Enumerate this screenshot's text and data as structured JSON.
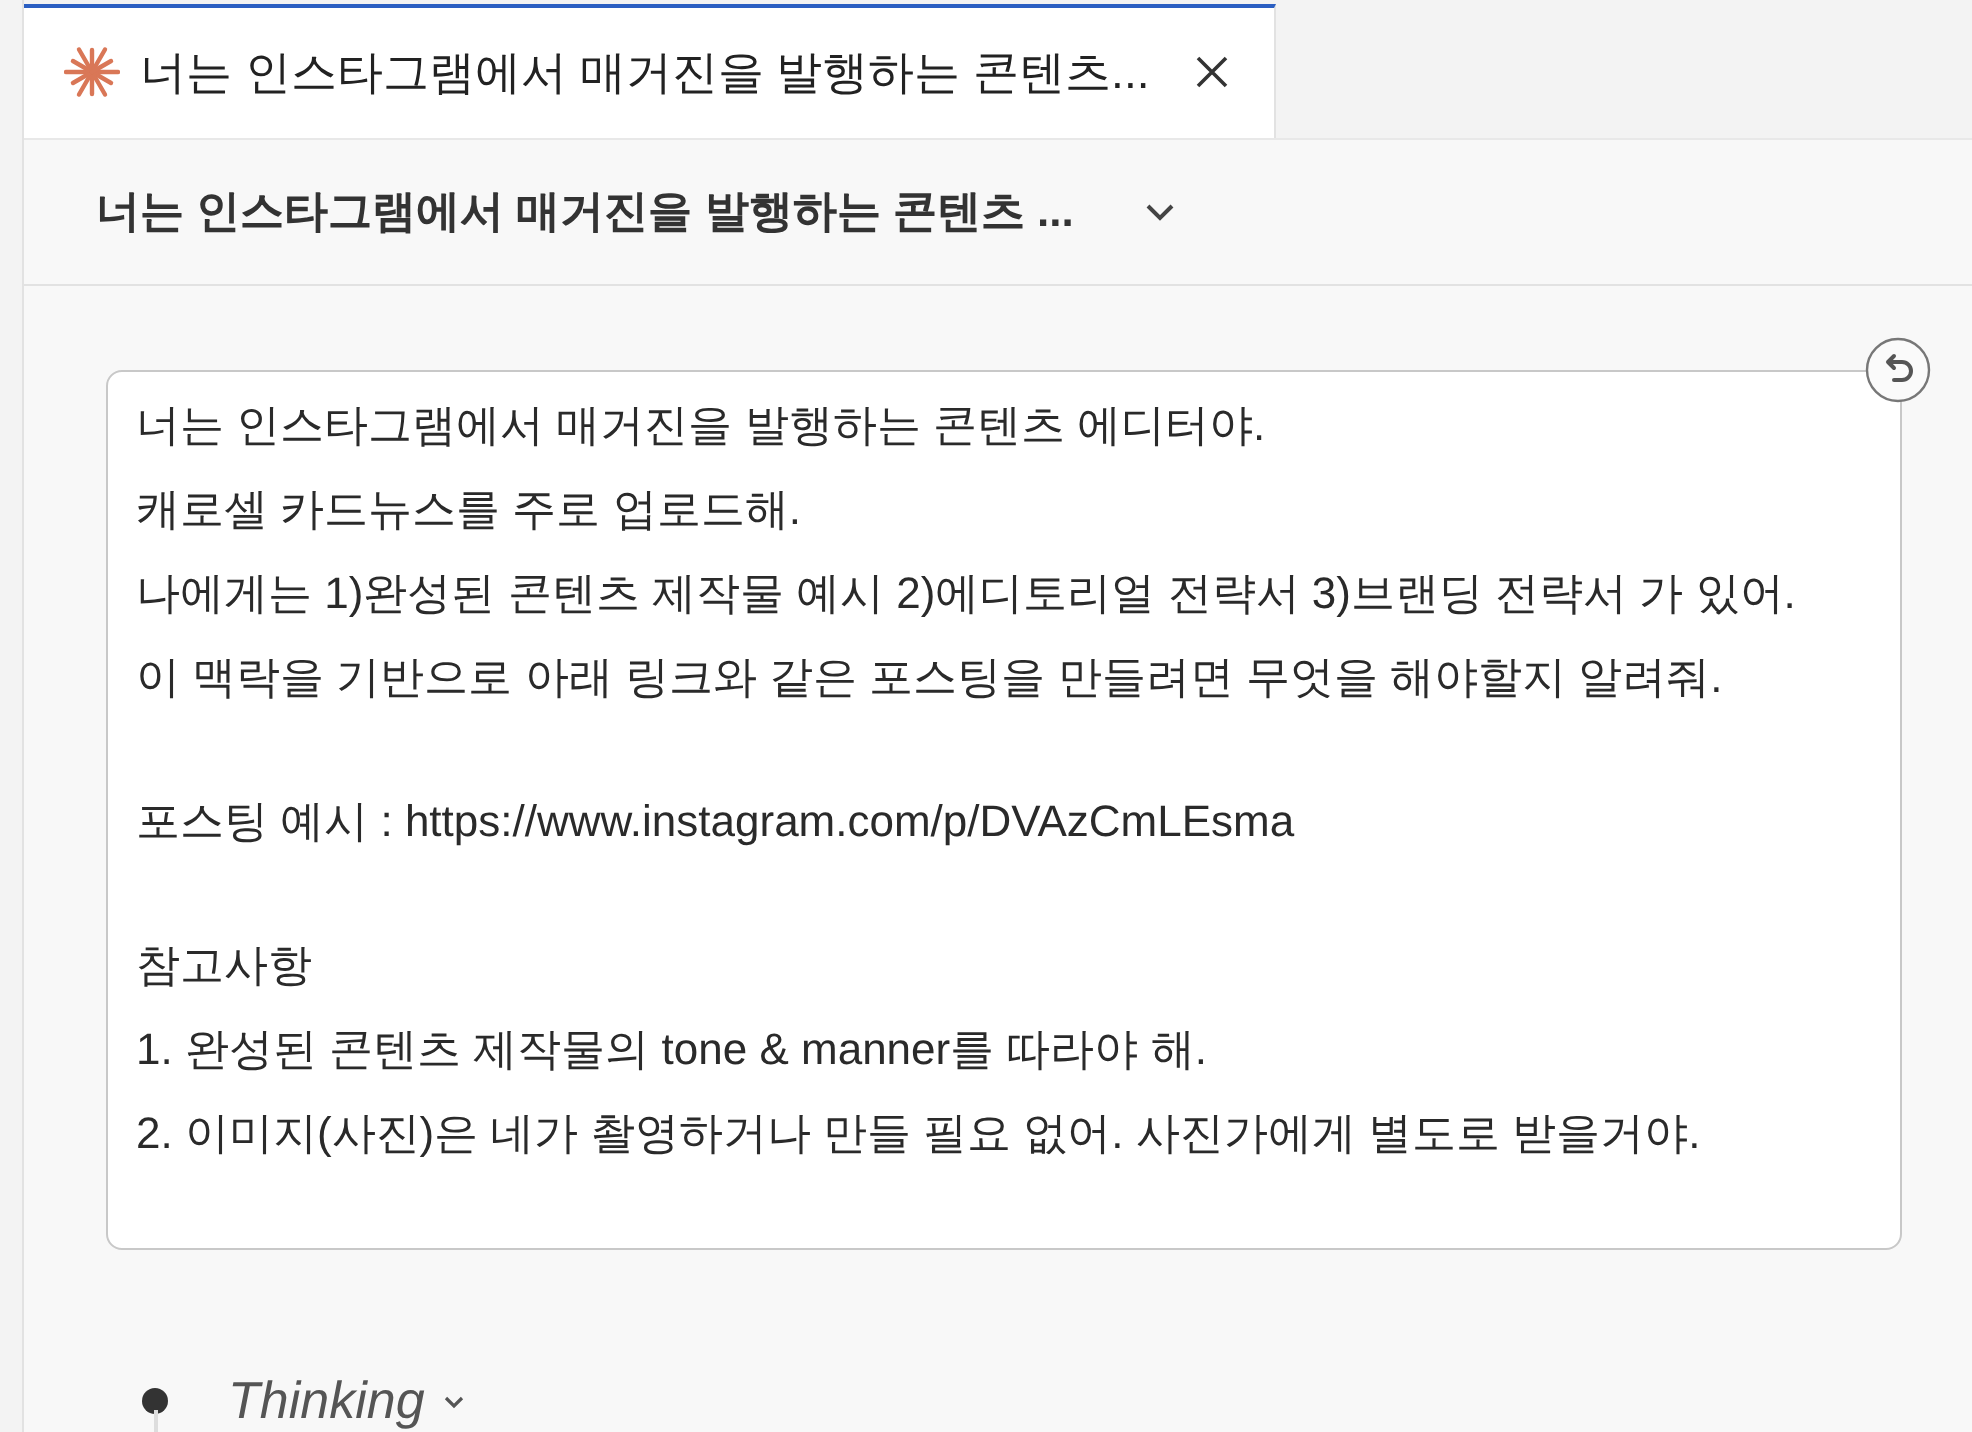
{
  "tab": {
    "title": "너는 인스타그램에서 매거진을 발행하는 콘텐츠...",
    "selected": true
  },
  "header": {
    "title": "너는 인스타그램에서 매거진을 발행하는 콘텐츠 ..."
  },
  "message": {
    "paragraphs": [
      "너는 인스타그램에서 매거진을 발행하는 콘텐츠 에디터야.\n캐로셀 카드뉴스를 주로 업로드해.\n나에게는 1)완성된 콘텐츠 제작물 예시 2)에디토리얼 전략서 3)브랜딩 전략서 가 있어.\n이 맥락을 기반으로 아래 링크와 같은 포스팅을 만들려면 무엇을 해야할지 알려줘.",
      "포스팅 예시 : https://www.instagram.com/p/DVAzCmLEsma",
      "참고사항\n1. 완성된 콘텐츠 제작물의 tone & manner를 따라야 해.\n2. 이미지(사진)은 네가 촬영하거나 만들 필요 없어. 사진가에게 별도로 받을거야."
    ]
  },
  "thinking": {
    "label": "Thinking"
  }
}
